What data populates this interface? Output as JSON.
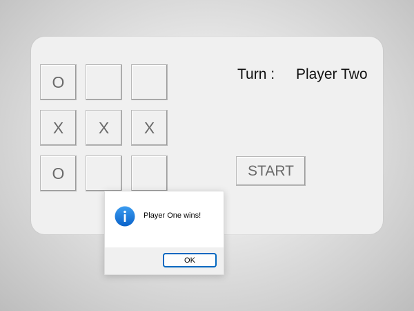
{
  "board": {
    "cells": [
      "O",
      "",
      "",
      "X",
      "X",
      "X",
      "O",
      "",
      ""
    ]
  },
  "turn": {
    "label": "Turn :",
    "value": "Player Two"
  },
  "start_button": {
    "label": "START"
  },
  "dialog": {
    "message": "Player One wins!",
    "ok_label": "OK",
    "icon": "info-icon",
    "icon_color": "#1b7fe0"
  }
}
